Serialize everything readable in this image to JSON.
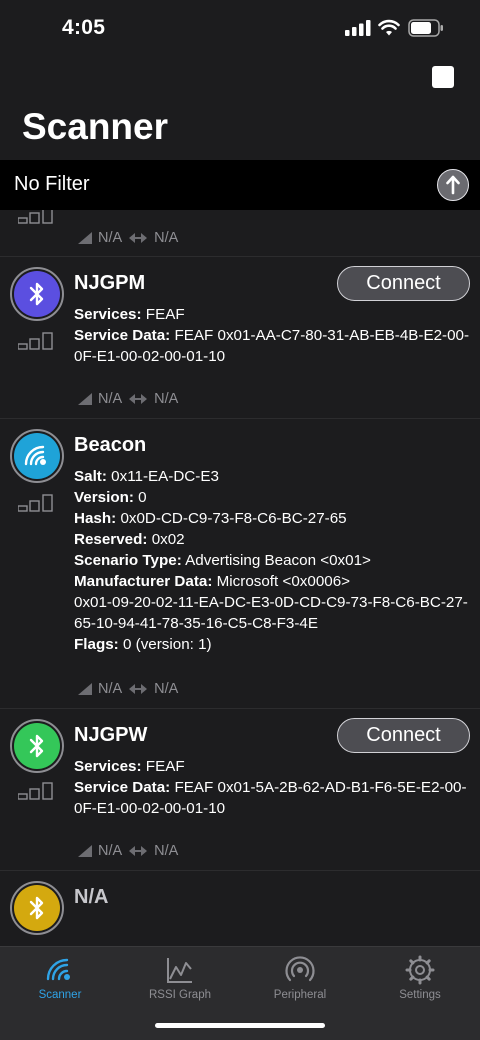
{
  "status": {
    "time": "4:05"
  },
  "header": {
    "title": "Scanner"
  },
  "filter": {
    "label": "No Filter"
  },
  "peripherals": [
    {
      "rssi": "N/A",
      "interval": "N/A"
    },
    {
      "name": "NJGPM",
      "connect": "Connect",
      "avatar_color": "#5b4fe0",
      "avatar_icon": "bluetooth-icon",
      "services_label": "Services:",
      "services": "FEAF",
      "service_data_label": "Service Data:",
      "service_data": "FEAF 0x01-AA-C7-80-31-AB-EB-4B-E2-00-0F-E1-00-02-00-01-10",
      "rssi": "N/A",
      "interval": "N/A"
    },
    {
      "name": "Beacon",
      "avatar_color": "#1fa3d8",
      "avatar_icon": "beacon-icon",
      "fields": [
        {
          "label": "Salt:",
          "value": "0x11-EA-DC-E3"
        },
        {
          "label": "Version:",
          "value": "0"
        },
        {
          "label": "Hash:",
          "value": "0x0D-CD-C9-73-F8-C6-BC-27-65"
        },
        {
          "label": "Reserved:",
          "value": "0x02"
        },
        {
          "label": "Scenario Type:",
          "value": "Advertising Beacon <0x01>"
        },
        {
          "label": "Manufacturer Data:",
          "value": "Microsoft <0x0006>"
        }
      ],
      "manufacturer_raw": "0x01-09-20-02-11-EA-DC-E3-0D-CD-C9-73-F8-C6-BC-27-65-10-94-41-78-35-16-C5-C8-F3-4E",
      "flags_label": "Flags:",
      "flags": "0 (version: 1)",
      "rssi": "N/A",
      "interval": "N/A"
    },
    {
      "name": "NJGPW",
      "connect": "Connect",
      "avatar_color": "#34c759",
      "avatar_icon": "bluetooth-icon",
      "services_label": "Services:",
      "services": "FEAF",
      "service_data_label": "Service Data:",
      "service_data": "FEAF 0x01-5A-2B-62-AD-B1-F6-5E-E2-00-0F-E1-00-02-00-01-10",
      "rssi": "N/A",
      "interval": "N/A"
    },
    {
      "name": "N/A",
      "avatar_color": "#d4a90f",
      "avatar_icon": "bluetooth-icon"
    }
  ],
  "tabs": [
    {
      "label": "Scanner",
      "icon": "scanner-icon",
      "active": true
    },
    {
      "label": "RSSI Graph",
      "icon": "graph-icon",
      "active": false
    },
    {
      "label": "Peripheral",
      "icon": "peripheral-icon",
      "active": false
    },
    {
      "label": "Settings",
      "icon": "gear-icon",
      "active": false
    }
  ],
  "colors": {
    "accent": "#2fa3e6",
    "background": "#1c1c1e"
  }
}
